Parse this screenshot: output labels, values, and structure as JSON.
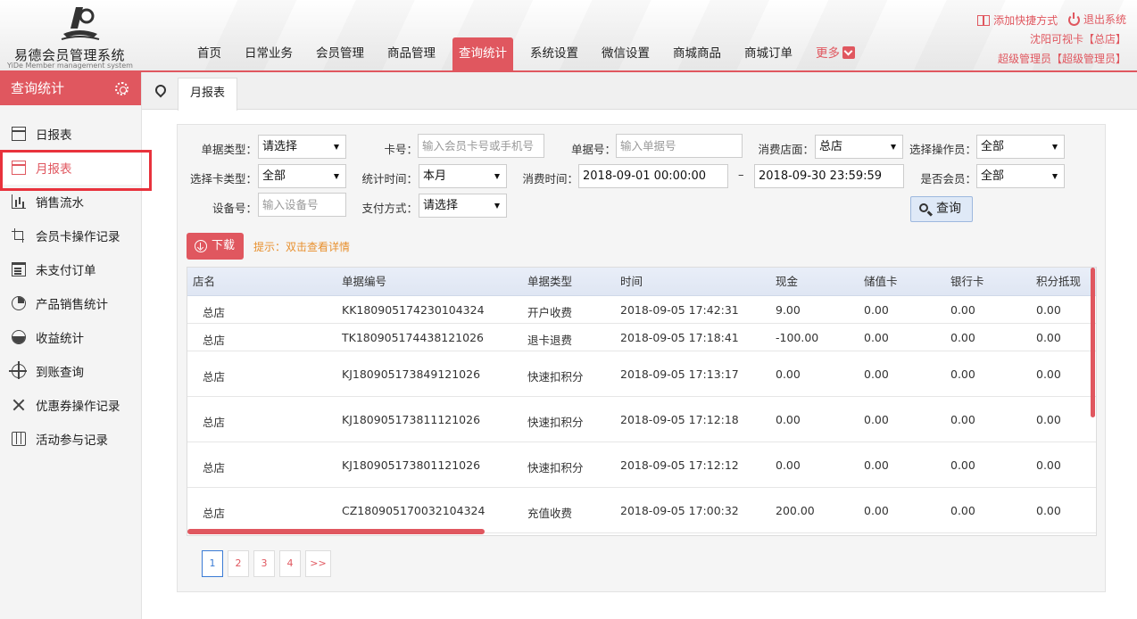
{
  "app": {
    "logo_title": "易德会员管理系统",
    "logo_subtitle": "YiDe Member management system"
  },
  "nav": {
    "items": [
      "首页",
      "日常业务",
      "会员管理",
      "商品管理",
      "查询统计",
      "系统设置",
      "微信设置",
      "商城商品",
      "商城订单",
      "更多"
    ],
    "active": "查询统计"
  },
  "top_right": {
    "add_shortcut": "添加快捷方式",
    "logout": "退出系统",
    "store_info": "沈阳可视卡【总店】",
    "user_info": "超级管理员【超级管理员】"
  },
  "sidebar": {
    "title": "查询统计",
    "items": [
      {
        "label": "日报表",
        "icon": "table-icon"
      },
      {
        "label": "月报表",
        "icon": "table-icon"
      },
      {
        "label": "销售流水",
        "icon": "bar-chart-icon"
      },
      {
        "label": "会员卡操作记录",
        "icon": "crop-icon"
      },
      {
        "label": "未支付订单",
        "icon": "calendar-icon"
      },
      {
        "label": "产品销售统计",
        "icon": "pie-chart-icon"
      },
      {
        "label": "收益统计",
        "icon": "half-circle-icon"
      },
      {
        "label": "到账查询",
        "icon": "crosshair-icon"
      },
      {
        "label": "优惠券操作记录",
        "icon": "shuffle-icon"
      },
      {
        "label": "活动参与记录",
        "icon": "map-icon"
      }
    ],
    "active": "月报表"
  },
  "tabs": {
    "active_tab": "月报表"
  },
  "filters": {
    "doc_type_label": "单据类型：",
    "doc_type_value": "请选择",
    "card_no_label": "卡号：",
    "card_no_placeholder": "输入会员卡号或手机号",
    "doc_no_label": "单据号：",
    "doc_no_placeholder": "输入单据号",
    "store_label": "消费店面：",
    "store_value": "总店",
    "operator_label": "选择操作员：",
    "operator_value": "全部",
    "card_type_label": "选择卡类型：",
    "card_type_value": "全部",
    "stat_time_label": "统计时间：",
    "stat_time_value": "本月",
    "consume_time_label": "消费时间：",
    "start_time": "2018-09-01 00:00:00",
    "range_separator": "–",
    "end_time": "2018-09-30 23:59:59",
    "is_member_label": "是否会员：",
    "is_member_value": "全部",
    "device_label": "设备号：",
    "device_placeholder": "输入设备号",
    "pay_method_label": "支付方式：",
    "pay_method_value": "请选择",
    "search_button": "查询"
  },
  "actions": {
    "download_button": "下载",
    "hint": "提示：双击查看详情"
  },
  "table": {
    "columns": [
      "店名",
      "单据编号",
      "单据类型",
      "时间",
      "现金",
      "储值卡",
      "银行卡",
      "积分抵现"
    ],
    "rows": [
      [
        "总店",
        "KK180905174230104324",
        "开户收费",
        "2018-09-05 17:42:31",
        "9.00",
        "0.00",
        "0.00",
        "0.00"
      ],
      [
        "总店",
        "TK180905174438121026",
        "退卡退费",
        "2018-09-05 17:18:41",
        "-100.00",
        "0.00",
        "0.00",
        "0.00"
      ],
      [
        "总店",
        "KJ180905173849121026",
        "快速扣积分",
        "2018-09-05 17:13:17",
        "0.00",
        "0.00",
        "0.00",
        "0.00"
      ],
      [
        "总店",
        "KJ180905173811121026",
        "快速扣积分",
        "2018-09-05 17:12:18",
        "0.00",
        "0.00",
        "0.00",
        "0.00"
      ],
      [
        "总店",
        "KJ180905173801121026",
        "快速扣积分",
        "2018-09-05 17:12:12",
        "0.00",
        "0.00",
        "0.00",
        "0.00"
      ],
      [
        "总店",
        "CZ180905170032104324",
        "充值收费",
        "2018-09-05 17:00:32",
        "200.00",
        "0.00",
        "0.00",
        "0.00"
      ]
    ]
  },
  "pagination": {
    "pages": [
      "1",
      "2",
      "3",
      "4"
    ],
    "current": "1",
    "next_label": ">>"
  },
  "colors": {
    "accent": "#e0575f",
    "hint": "#e8902e",
    "page_active": "#3a7bd5"
  }
}
